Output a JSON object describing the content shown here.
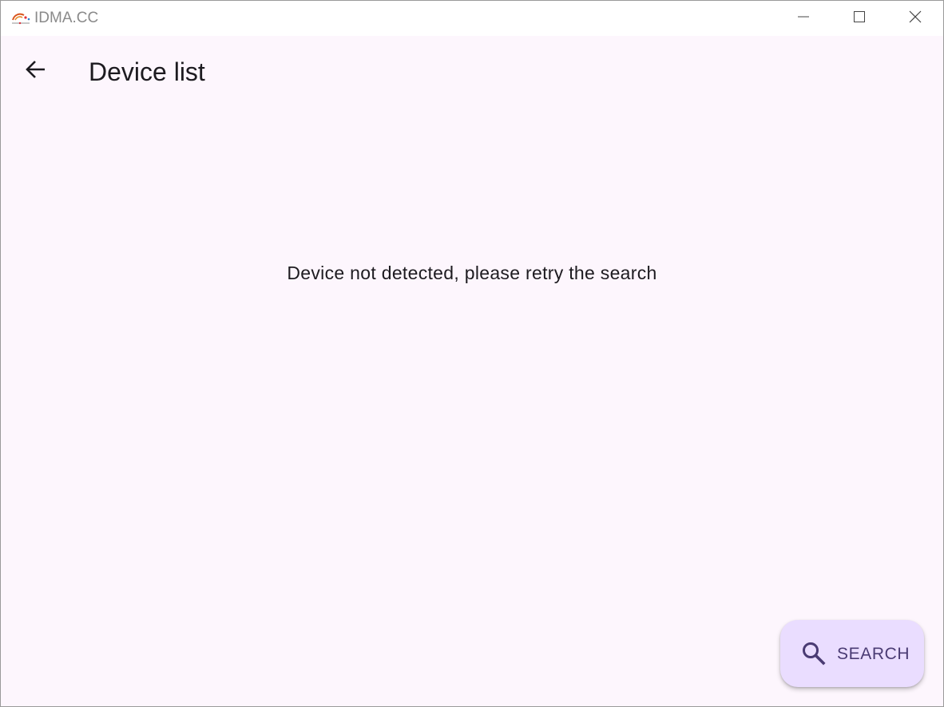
{
  "window": {
    "title": "IDMA.CC",
    "icon": "app-logo-icon",
    "controls": {
      "minimize_icon": "minimize-icon",
      "maximize_icon": "maximize-icon",
      "close_icon": "close-icon"
    }
  },
  "appbar": {
    "back_icon": "arrow-back-icon",
    "title": "Device list"
  },
  "main": {
    "empty_message": "Device not detected, please retry the search"
  },
  "fab": {
    "icon": "search-icon",
    "label": "SEARCH"
  },
  "colors": {
    "background": "#fdf6fd",
    "fab_background": "#eaddff",
    "fab_foreground": "#4a3b73",
    "text": "#1d1b20"
  }
}
